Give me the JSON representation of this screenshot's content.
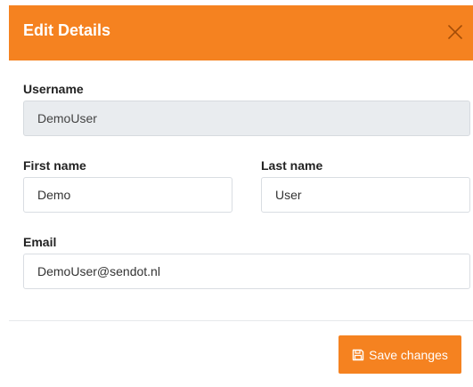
{
  "modal": {
    "title": "Edit Details",
    "close_icon": "close-icon",
    "header_color": "#f58220"
  },
  "form": {
    "username": {
      "label": "Username",
      "value": "DemoUser"
    },
    "first_name": {
      "label": "First name",
      "value": "Demo"
    },
    "last_name": {
      "label": "Last name",
      "value": "User"
    },
    "email": {
      "label": "Email",
      "value": "DemoUser@sendot.nl"
    }
  },
  "footer": {
    "save_label": "Save changes",
    "save_icon": "floppy-disk-icon",
    "button_color": "#f58220"
  }
}
